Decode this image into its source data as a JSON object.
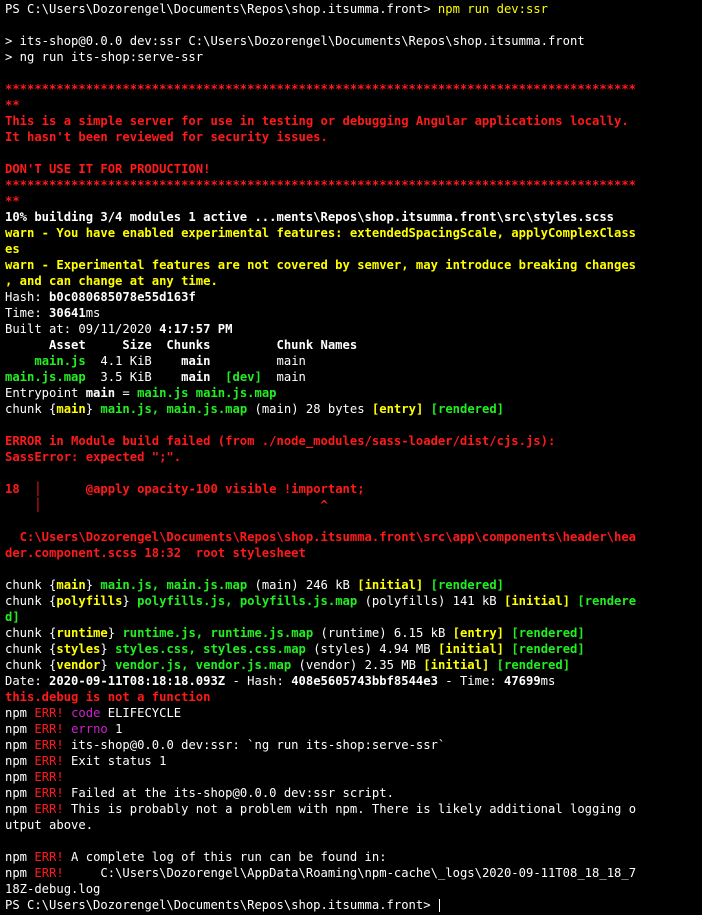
{
  "colors": {
    "background": "#000000",
    "white": "#ffffff",
    "yellow": "#ffff00",
    "red": "#ff1a1a",
    "green": "#22ee22",
    "magenta": "#cc22cc"
  },
  "terminal": {
    "cursor": "block-bar",
    "lines": [
      [
        {
          "t": "PS C:\\Users\\Dozorengel\\Documents\\Repos\\shop.itsumma.front> ",
          "c": "white"
        },
        {
          "t": "npm run dev:ssr",
          "c": "yellow"
        }
      ],
      [],
      [
        {
          "t": "> its-shop@0.0.0 dev:ssr C:\\Users\\Dozorengel\\Documents\\Repos\\shop.itsumma.front",
          "c": "white"
        }
      ],
      [
        {
          "t": "> ng run its-shop:serve-ssr",
          "c": "white"
        }
      ],
      [],
      [
        {
          "t": "**************************************************************************************",
          "c": "red",
          "b": true
        }
      ],
      [
        {
          "t": "**",
          "c": "red",
          "b": true
        }
      ],
      [
        {
          "t": "This is a simple server for use in testing or debugging Angular applications locally.",
          "c": "red",
          "b": true
        }
      ],
      [
        {
          "t": "It hasn't been reviewed for security issues.",
          "c": "red",
          "b": true
        }
      ],
      [],
      [
        {
          "t": "DON'T USE IT FOR PRODUCTION!",
          "c": "red",
          "b": true
        }
      ],
      [
        {
          "t": "**************************************************************************************",
          "c": "red",
          "b": true
        }
      ],
      [
        {
          "t": "**",
          "c": "red",
          "b": true
        }
      ],
      [
        {
          "t": "10% building 3/4 modules 1 active ...ments\\Repos\\shop.itsumma.front\\src\\styles.scss",
          "c": "white",
          "b": true
        }
      ],
      [
        {
          "t": "warn - You have enabled experimental features: extendedSpacingScale, applyComplexClass",
          "c": "yellow",
          "b": true
        }
      ],
      [
        {
          "t": "es",
          "c": "yellow",
          "b": true
        }
      ],
      [
        {
          "t": "warn - Experimental features are not covered by semver, may introduce breaking changes",
          "c": "yellow",
          "b": true
        }
      ],
      [
        {
          "t": ", and can change at any time.",
          "c": "yellow",
          "b": true
        }
      ],
      [
        {
          "t": "Hash: ",
          "c": "white"
        },
        {
          "t": "b0c080685078e55d163f",
          "c": "white",
          "b": true
        }
      ],
      [
        {
          "t": "Time: ",
          "c": "white"
        },
        {
          "t": "30641",
          "c": "white",
          "b": true
        },
        {
          "t": "ms",
          "c": "white"
        }
      ],
      [
        {
          "t": "Built at: 09/11/2020 ",
          "c": "white"
        },
        {
          "t": "4:17:57 PM",
          "c": "white",
          "b": true
        }
      ],
      [
        {
          "t": "      Asset     Size  Chunks         Chunk Names",
          "c": "white",
          "b": true
        }
      ],
      [
        {
          "t": "    ",
          "c": "white"
        },
        {
          "t": "main.js",
          "c": "green",
          "b": true
        },
        {
          "t": "  4.1 KiB    ",
          "c": "white"
        },
        {
          "t": "main",
          "c": "white",
          "b": true
        },
        {
          "t": "         main",
          "c": "white"
        }
      ],
      [
        {
          "t": "main.js.map",
          "c": "green",
          "b": true
        },
        {
          "t": "  3.5 KiB    ",
          "c": "white"
        },
        {
          "t": "main",
          "c": "white",
          "b": true
        },
        {
          "t": "  ",
          "c": "white"
        },
        {
          "t": "[dev]",
          "c": "green",
          "b": true
        },
        {
          "t": "  main",
          "c": "white"
        }
      ],
      [
        {
          "t": "Entrypoint ",
          "c": "white"
        },
        {
          "t": "main",
          "c": "white",
          "b": true
        },
        {
          "t": " = ",
          "c": "white"
        },
        {
          "t": "main.js main.js.map",
          "c": "green",
          "b": true
        }
      ],
      [
        {
          "t": "chunk {",
          "c": "white"
        },
        {
          "t": "main",
          "c": "yellow",
          "b": true
        },
        {
          "t": "} ",
          "c": "white"
        },
        {
          "t": "main.js, main.js.map",
          "c": "green",
          "b": true
        },
        {
          "t": " (main) 28 bytes ",
          "c": "white"
        },
        {
          "t": "[entry]",
          "c": "yellow",
          "b": true
        },
        {
          "t": " ",
          "c": "white"
        },
        {
          "t": "[rendered]",
          "c": "green",
          "b": true
        }
      ],
      [],
      [
        {
          "t": "ERROR in Module build failed (from ./node_modules/sass-loader/dist/cjs.js):",
          "c": "red",
          "b": true
        }
      ],
      [
        {
          "t": "SassError: expected \";\".",
          "c": "red",
          "b": true
        }
      ],
      [],
      [
        {
          "t": "18  ",
          "c": "red",
          "b": true
        },
        {
          "t": "│",
          "c": "red"
        },
        {
          "t": "      ",
          "c": "red"
        },
        {
          "t": "@apply opacity-100 visible !important;",
          "c": "red",
          "b": true
        }
      ],
      [
        {
          "t": "    ",
          "c": "red"
        },
        {
          "t": "│",
          "c": "red"
        },
        {
          "t": "                                      ^",
          "c": "red",
          "b": true
        }
      ],
      [],
      [
        {
          "t": "  C:\\Users\\Dozorengel\\Documents\\Repos\\shop.itsumma.front\\src\\app\\components\\header\\hea",
          "c": "red",
          "b": true
        }
      ],
      [
        {
          "t": "der.component.scss 18:32  root stylesheet",
          "c": "red",
          "b": true
        }
      ],
      [],
      [
        {
          "t": "chunk {",
          "c": "white"
        },
        {
          "t": "main",
          "c": "yellow",
          "b": true
        },
        {
          "t": "} ",
          "c": "white"
        },
        {
          "t": "main.js, main.js.map",
          "c": "green",
          "b": true
        },
        {
          "t": " (main) 246 kB ",
          "c": "white"
        },
        {
          "t": "[initial]",
          "c": "yellow",
          "b": true
        },
        {
          "t": " ",
          "c": "white"
        },
        {
          "t": "[rendered]",
          "c": "green",
          "b": true
        }
      ],
      [
        {
          "t": "chunk {",
          "c": "white"
        },
        {
          "t": "polyfills",
          "c": "yellow",
          "b": true
        },
        {
          "t": "} ",
          "c": "white"
        },
        {
          "t": "polyfills.js, polyfills.js.map",
          "c": "green",
          "b": true
        },
        {
          "t": " (polyfills) 141 kB ",
          "c": "white"
        },
        {
          "t": "[initial]",
          "c": "yellow",
          "b": true
        },
        {
          "t": " ",
          "c": "white"
        },
        {
          "t": "[rendere",
          "c": "green",
          "b": true
        }
      ],
      [
        {
          "t": "d]",
          "c": "green",
          "b": true
        }
      ],
      [
        {
          "t": "chunk {",
          "c": "white"
        },
        {
          "t": "runtime",
          "c": "yellow",
          "b": true
        },
        {
          "t": "} ",
          "c": "white"
        },
        {
          "t": "runtime.js, runtime.js.map",
          "c": "green",
          "b": true
        },
        {
          "t": " (runtime) 6.15 kB ",
          "c": "white"
        },
        {
          "t": "[entry]",
          "c": "yellow",
          "b": true
        },
        {
          "t": " ",
          "c": "white"
        },
        {
          "t": "[rendered]",
          "c": "green",
          "b": true
        }
      ],
      [
        {
          "t": "chunk {",
          "c": "white"
        },
        {
          "t": "styles",
          "c": "yellow",
          "b": true
        },
        {
          "t": "} ",
          "c": "white"
        },
        {
          "t": "styles.css, styles.css.map",
          "c": "green",
          "b": true
        },
        {
          "t": " (styles) 4.94 MB ",
          "c": "white"
        },
        {
          "t": "[initial]",
          "c": "yellow",
          "b": true
        },
        {
          "t": " ",
          "c": "white"
        },
        {
          "t": "[rendered]",
          "c": "green",
          "b": true
        }
      ],
      [
        {
          "t": "chunk {",
          "c": "white"
        },
        {
          "t": "vendor",
          "c": "yellow",
          "b": true
        },
        {
          "t": "} ",
          "c": "white"
        },
        {
          "t": "vendor.js, vendor.js.map",
          "c": "green",
          "b": true
        },
        {
          "t": " (vendor) 2.35 MB ",
          "c": "white"
        },
        {
          "t": "[initial]",
          "c": "yellow",
          "b": true
        },
        {
          "t": " ",
          "c": "white"
        },
        {
          "t": "[rendered]",
          "c": "green",
          "b": true
        }
      ],
      [
        {
          "t": "Date: ",
          "c": "white"
        },
        {
          "t": "2020-09-11T08:18:18.093Z",
          "c": "white",
          "b": true
        },
        {
          "t": " - Hash: ",
          "c": "white"
        },
        {
          "t": "408e5605743bbf8544e3",
          "c": "white",
          "b": true
        },
        {
          "t": " - Time: ",
          "c": "white"
        },
        {
          "t": "47699",
          "c": "white",
          "b": true
        },
        {
          "t": "ms",
          "c": "white"
        }
      ],
      [
        {
          "t": "this.debug is not a function",
          "c": "red",
          "b": true
        }
      ],
      [
        {
          "t": "npm ",
          "c": "white"
        },
        {
          "t": "ERR!",
          "c": "red"
        },
        {
          "t": " ",
          "c": "white"
        },
        {
          "t": "code",
          "c": "magenta"
        },
        {
          "t": " ELIFECYCLE",
          "c": "white"
        }
      ],
      [
        {
          "t": "npm ",
          "c": "white"
        },
        {
          "t": "ERR!",
          "c": "red"
        },
        {
          "t": " ",
          "c": "white"
        },
        {
          "t": "errno",
          "c": "magenta"
        },
        {
          "t": " 1",
          "c": "white"
        }
      ],
      [
        {
          "t": "npm ",
          "c": "white"
        },
        {
          "t": "ERR!",
          "c": "red"
        },
        {
          "t": " its-shop@0.0.0 dev:ssr: `ng run its-shop:serve-ssr`",
          "c": "white"
        }
      ],
      [
        {
          "t": "npm ",
          "c": "white"
        },
        {
          "t": "ERR!",
          "c": "red"
        },
        {
          "t": " Exit status 1",
          "c": "white"
        }
      ],
      [
        {
          "t": "npm ",
          "c": "white"
        },
        {
          "t": "ERR!",
          "c": "red"
        }
      ],
      [
        {
          "t": "npm ",
          "c": "white"
        },
        {
          "t": "ERR!",
          "c": "red"
        },
        {
          "t": " Failed at the its-shop@0.0.0 dev:ssr script.",
          "c": "white"
        }
      ],
      [
        {
          "t": "npm ",
          "c": "white"
        },
        {
          "t": "ERR!",
          "c": "red"
        },
        {
          "t": " This is probably not a problem with npm. There is likely additional logging o",
          "c": "white"
        }
      ],
      [
        {
          "t": "utput above.",
          "c": "white"
        }
      ],
      [],
      [
        {
          "t": "npm ",
          "c": "white"
        },
        {
          "t": "ERR!",
          "c": "red"
        },
        {
          "t": " A complete log of this run can be found in:",
          "c": "white"
        }
      ],
      [
        {
          "t": "npm ",
          "c": "white"
        },
        {
          "t": "ERR!",
          "c": "red"
        },
        {
          "t": "     C:\\Users\\Dozorengel\\AppData\\Roaming\\npm-cache\\_logs\\2020-09-11T08_18_18_7",
          "c": "white"
        }
      ],
      [
        {
          "t": "18Z-debug.log",
          "c": "white"
        }
      ],
      [
        {
          "t": "PS C:\\Users\\Dozorengel\\Documents\\Repos\\shop.itsumma.front> ",
          "c": "white"
        }
      ]
    ]
  }
}
